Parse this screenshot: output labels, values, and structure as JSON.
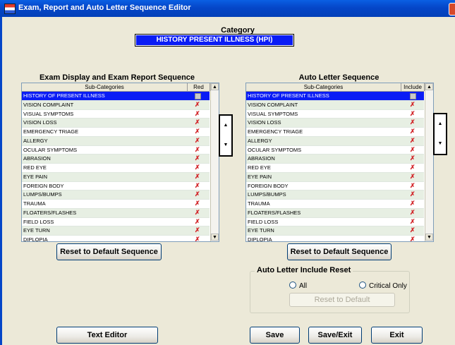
{
  "window": {
    "title": "Exam, Report and Auto Letter Sequence Editor"
  },
  "category": {
    "label": "Category",
    "value": "HISTORY PRESENT ILLNESS (HPI)"
  },
  "left_panel": {
    "title": "Exam Display and Exam Report Sequence",
    "columns": [
      "Sub-Categories",
      "Red"
    ],
    "rows": [
      {
        "name": "HISTORY OF PRESENT ILLNESS",
        "check": "empty",
        "selected": true
      },
      {
        "name": "VISION COMPLAINT",
        "check": "x"
      },
      {
        "name": "VISUAL SYMPTOMS",
        "check": "x"
      },
      {
        "name": "VISION LOSS",
        "check": "x"
      },
      {
        "name": "EMERGENCY TRIAGE",
        "check": "x"
      },
      {
        "name": "ALLERGY",
        "check": "x"
      },
      {
        "name": "OCULAR SYMPTOMS",
        "check": "x"
      },
      {
        "name": "ABRASION",
        "check": "x"
      },
      {
        "name": "RED EYE",
        "check": "x"
      },
      {
        "name": "EYE PAIN",
        "check": "x"
      },
      {
        "name": "FOREIGN BODY",
        "check": "x"
      },
      {
        "name": "LUMPS/BUMPS",
        "check": "x"
      },
      {
        "name": "TRAUMA",
        "check": "x"
      },
      {
        "name": "FLOATERS/FLASHES",
        "check": "x"
      },
      {
        "name": "FIELD LOSS",
        "check": "x"
      },
      {
        "name": "EYE TURN",
        "check": "x"
      },
      {
        "name": "DIPLOPIA",
        "check": "x"
      }
    ],
    "reset_button": "Reset to Default Sequence"
  },
  "right_panel": {
    "title": "Auto Letter Sequence",
    "columns": [
      "Sub-Categories",
      "Include"
    ],
    "rows": [
      {
        "name": "HISTORY OF PRESENT ILLNESS",
        "check": "empty",
        "selected": true
      },
      {
        "name": "VISION COMPLAINT",
        "check": "x"
      },
      {
        "name": "VISUAL SYMPTOMS",
        "check": "x"
      },
      {
        "name": "VISION LOSS",
        "check": "x"
      },
      {
        "name": "EMERGENCY TRIAGE",
        "check": "x"
      },
      {
        "name": "ALLERGY",
        "check": "x"
      },
      {
        "name": "OCULAR SYMPTOMS",
        "check": "x"
      },
      {
        "name": "ABRASION",
        "check": "x"
      },
      {
        "name": "RED EYE",
        "check": "x"
      },
      {
        "name": "EYE PAIN",
        "check": "x"
      },
      {
        "name": "FOREIGN BODY",
        "check": "x"
      },
      {
        "name": "LUMPS/BUMPS",
        "check": "x"
      },
      {
        "name": "TRAUMA",
        "check": "x"
      },
      {
        "name": "FLOATERS/FLASHES",
        "check": "x"
      },
      {
        "name": "FIELD LOSS",
        "check": "x"
      },
      {
        "name": "EYE TURN",
        "check": "x"
      },
      {
        "name": "DIPLOPIA",
        "check": "x"
      }
    ],
    "reset_button": "Reset to Default Sequence"
  },
  "include_reset": {
    "legend": "Auto Letter Include Reset",
    "option_all": "All",
    "option_critical": "Critical Only",
    "button": "Reset to Default"
  },
  "footer": {
    "text_editor": "Text Editor",
    "save": "Save",
    "save_exit": "Save/Exit",
    "exit": "Exit"
  },
  "colors": {
    "selection": "#0A1CF5",
    "title_bar": "#0546C8",
    "check_mark": "#D2262A"
  }
}
